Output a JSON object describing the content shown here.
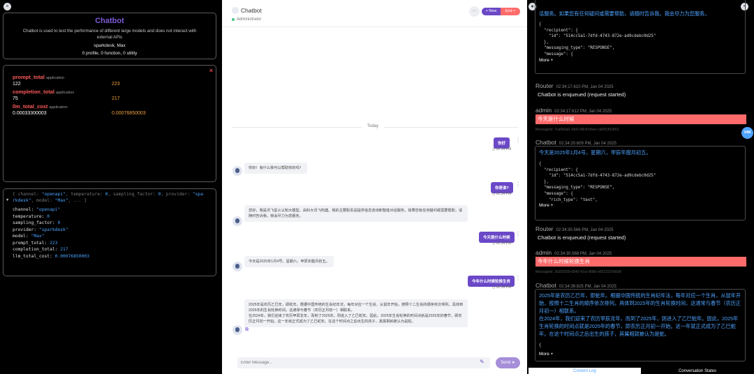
{
  "left": {
    "close_icon": "×",
    "info": {
      "title": "Chatbot",
      "description": "Chatbot is used to test the performance of different large models and does not interact with external APIs",
      "model": "sparkdesk, Max",
      "summary": "0 profile, 0 function, 0 utility"
    },
    "usage": {
      "close_icon": "×",
      "metrics": [
        {
          "key": "prompt_total",
          "tag": "application",
          "v1": "122",
          "v2": "223"
        },
        {
          "key": "completion_total",
          "tag": "application",
          "v1": "75",
          "v2": "217"
        },
        {
          "key": "llm_total_cost",
          "tag": "application",
          "v1": "0.00033300003",
          "v2": "0.00076850003"
        }
      ]
    },
    "code": {
      "summary_a": "{ channel: ",
      "summary_b": "\"openapi\"",
      "summary_c": ", temperature: ",
      "summary_d": "0",
      "summary_e": ", sampling_factor: ",
      "summary_f": "0",
      "summary_g": ", provider: ",
      "summary_h": "\"spa",
      "summary2_a": "rkdesk\"",
      "summary2_b": ", model: ",
      "summary2_c": "\"Max\"",
      "summary2_d": ", ... }",
      "lines": [
        {
          "k": "channel: ",
          "v": "\"openapi\""
        },
        {
          "k": "temperature: ",
          "v": "0"
        },
        {
          "k": "sampling_factor: ",
          "v": "0"
        },
        {
          "k": "provider: ",
          "v": "\"sparkdesk\""
        },
        {
          "k": "model: ",
          "v": "\"Max\""
        },
        {
          "k": "prompt_total: ",
          "v": "223"
        },
        {
          "k": "completion_total: ",
          "v": "217"
        },
        {
          "k": "llm_total_cost: ",
          "v": "0.00076850003"
        }
      ]
    }
  },
  "center": {
    "title": "Chatbot",
    "role": "Administrator",
    "more_icon": "···",
    "new_label": "+ New",
    "end_label": "End ×",
    "day_label": "Today",
    "messages": {
      "u1": "你好",
      "u1_time": "02:34 PM",
      "b1": "你好！有什么我可以帮助你的吗？",
      "u2": "你是谁?",
      "u2_time": "02:34 PM",
      "b2": "您好，我是讯飞星火认知大模型，由科大讯飞构建。我的主要职责是提供信息咨询和智能对话服务。如果您有任何疑问或需要帮助，请随时告诉我，我会尽力为您服务。",
      "u3": "今天是什么时候",
      "u3_time": "02:34 PM",
      "b3": "今天是2025年1月4号，星期六，甲辰年腊月初五。",
      "u4": "今年什么时候轮换生肖",
      "u4_time": "02:34 PM",
      "b4_l1": "2025年是农历乙巳年，即蛇年。根据中国传统的生肖纪年法，每年对应一个生肖，从鼠年开始，按照十二生肖的顺序依次排列。具体到2025年的生肖轮换时间，这通常与春节（农历正月初一）相联系。",
      "b4_l2": "在2024年，我们迎来了农历甲辰龙年，而到了2025年，则进入了乙巳蛇年。因此，2025年生肖轮换的时间点就是2025年的春节，即农历正月初一开始。这一年就正式成为了乙巳蛇年。在这个时间点之后出生的孩子，其属相就被认为是蛇。"
    },
    "input_placeholder": "Enter Message...",
    "send_label": "Send ➤"
  },
  "right": {
    "close_icon": "×",
    "block1": {
      "cn": "话服务。如果您有任何疑问或需要帮助，请随时告诉我，我会尽力为您服务。",
      "l1": "{",
      "l2": "  \"recipient\": {",
      "l3": "    \"id\": \"514cc5a1-7dfd-4743-872e-ad9cdebc0d25\"",
      "l4": "  },",
      "l5": "  \"messaging_type\": \"RESPONSE\",",
      "l6": "  \"message\": {",
      "more": "More +"
    },
    "ev1": {
      "who": "Router",
      "time": "02:34:17.610 PM, Jan 04 2025",
      "text": "Chatbot is enqueued (request started)"
    },
    "ev2": {
      "who": "admin",
      "time": "02:34:17.612 PM, Jan 04 2025",
      "text": "今天是什么时候",
      "msgid": "MessageId: 7ca6b5a0-34d3-48c8-b5ee-ca655352b53"
    },
    "ev3": {
      "who": "Chatbot",
      "time": "02:34:20.609 PM, Jan 04 2025"
    },
    "block2": {
      "cn": "今天是2025年1月4号，星期六，甲辰年腊月初五。",
      "l1": "{",
      "l2": "  \"recipient\": {",
      "l3": "    \"id\": \"514cc5a1-7dfd-4743-872e-ad9cdebc0d25\"",
      "l4": "  },",
      "l5": "  \"messaging_type\": \"RESPONSE\",",
      "l6": "  \"message\": {",
      "l7": "    \"rich_type\": \"text\",",
      "more": "More +"
    },
    "ev4": {
      "who": "Router",
      "time": "02:34:30.566 PM, Jan 04 2025",
      "text": "Chatbot is enqueued (request started)"
    },
    "ev5": {
      "who": "admin",
      "time": "02:34:30.568 PM, Jan 04 2025",
      "text": "今年什么时候轮换生肖",
      "msgid": "MessageId: 2b302029-d540-42ce-808e-e8222337b0d8"
    },
    "ev6": {
      "who": "Chatbot",
      "time": "02:34:39.825 PM, Jan 04 2025"
    },
    "block3": {
      "cn1": "2025年是农历乙巳年，即蛇年。根据中国传统的生肖纪年法，每年对应一个生肖，从鼠年开始，按照十二生肖的顺序依次排列。具体到2025年的生肖轮换时间，这通常与春节（农历正月初一）相联系。",
      "cn2": "在2024年，我们迎来了农历甲辰龙年，而到了2025年，则进入了乙巳蛇年。因此，2025年生肖轮换的时间点就是2025年的春节，即农历正月初一开始。这一年就正式成为了乙巳蛇年。在这个时间点之后出生的孩子，其属相就被认为是蛇。",
      "l1": "{",
      "more": "More +"
    },
    "badge": "34M",
    "tab_log": "Content Log",
    "tab_state": "Conversation States"
  }
}
